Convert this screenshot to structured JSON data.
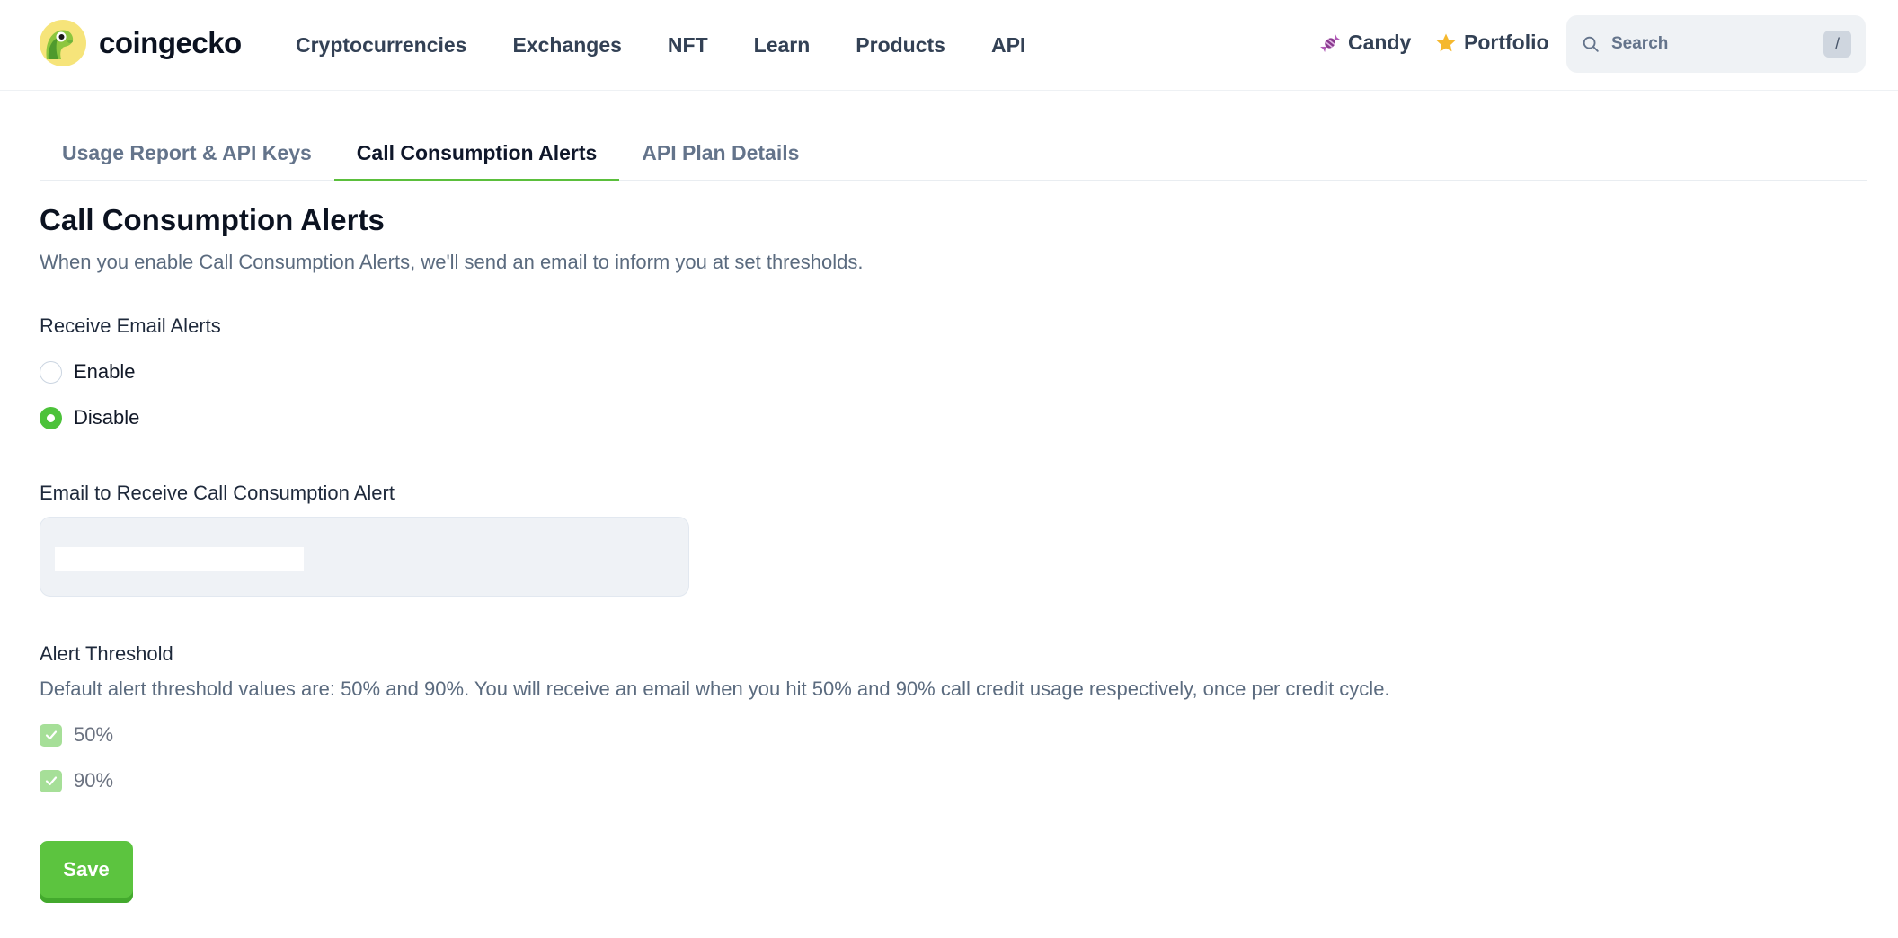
{
  "header": {
    "brand": "coingecko",
    "nav": [
      "Cryptocurrencies",
      "Exchanges",
      "NFT",
      "Learn",
      "Products",
      "API"
    ],
    "candy_label": "Candy",
    "portfolio_label": "Portfolio",
    "search_placeholder": "Search",
    "search_shortcut": "/"
  },
  "tabs": [
    {
      "label": "Usage Report & API Keys",
      "active": false
    },
    {
      "label": "Call Consumption Alerts",
      "active": true
    },
    {
      "label": "API Plan Details",
      "active": false
    }
  ],
  "main": {
    "title": "Call Consumption Alerts",
    "description": "When you enable Call Consumption Alerts, we'll send an email to inform you at set thresholds.",
    "email_alerts": {
      "label": "Receive Email Alerts",
      "options": [
        {
          "label": "Enable",
          "selected": false
        },
        {
          "label": "Disable",
          "selected": true
        }
      ]
    },
    "email_field": {
      "label": "Email to Receive Call Consumption Alert",
      "value": ""
    },
    "threshold": {
      "label": "Alert Threshold",
      "description": "Default alert threshold values are: 50% and 90%. You will receive an email when you hit 50% and 90% call credit usage respectively, once per credit cycle.",
      "options": [
        {
          "label": "50%",
          "checked": true
        },
        {
          "label": "90%",
          "checked": true
        }
      ]
    },
    "save_label": "Save"
  },
  "colors": {
    "accent": "#4cc23a",
    "checkbox_disabled": "#a6df98",
    "text_muted": "#5b6b7f"
  }
}
